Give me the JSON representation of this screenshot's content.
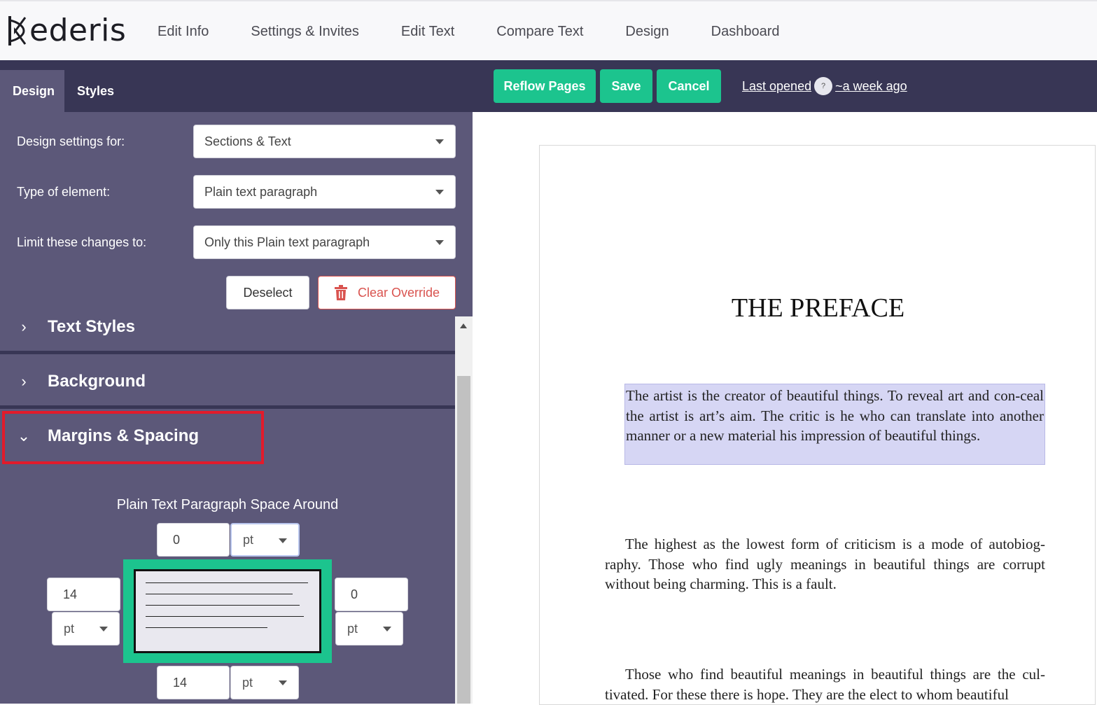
{
  "app": {
    "logo_text": "ederis"
  },
  "nav": {
    "items": [
      "Edit Info",
      "Settings & Invites",
      "Edit Text",
      "Compare Text",
      "Design",
      "Dashboard"
    ]
  },
  "toolbar": {
    "tabs": [
      "Design",
      "Styles"
    ],
    "reflow_label": "Reflow Pages",
    "save_label": "Save",
    "cancel_label": "Cancel",
    "last_opened_label": "Last opened",
    "help_label": "?",
    "last_opened_value": "~a week ago",
    "accent": "#1cc48e"
  },
  "panel": {
    "design_for_label": "Design settings for:",
    "design_for_value": "Sections & Text",
    "element_type_label": "Type of element:",
    "element_type_value": "Plain text paragraph",
    "limit_label": "Limit these changes to:",
    "limit_value": "Only this Plain text paragraph",
    "deselect_label": "Deselect",
    "clear_override_label": "Clear Override",
    "sections": [
      "Text Styles",
      "Background",
      "Margins & Spacing"
    ],
    "space_title": "Plain Text Paragraph Space Around",
    "top": {
      "value": "0",
      "unit": "pt"
    },
    "left": {
      "value": "14",
      "unit": "pt"
    },
    "right": {
      "value": "0",
      "unit": "pt"
    },
    "bottom": {
      "value": "14",
      "unit": "pt"
    }
  },
  "document": {
    "title": "THE PREFACE",
    "paragraphs": [
      "The artist is the creator of beautiful things. To reveal art and con-ceal the artist is art’s aim. The critic is he who can translate into another manner or a new material his impression of beautiful things.",
      "The highest as the lowest form of criticism is a mode of autobiog-raphy. Those who find ugly meanings in beautiful things are corrupt without being charming. This is a fault.",
      "Those who find beautiful meanings in beautiful things are the cul-tivated. For these there is hope. They are the elect to whom beautiful"
    ]
  }
}
